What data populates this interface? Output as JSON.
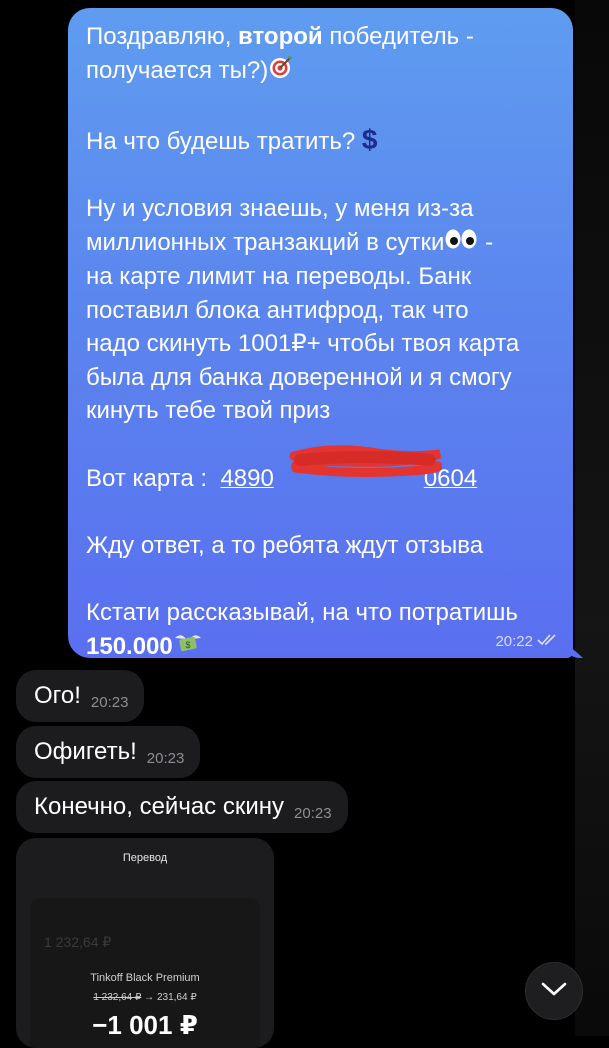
{
  "outgoing_message": {
    "line1_prefix": "Поздравляю, ",
    "line1_bold": "второй",
    "line1_suffix": " победитель -",
    "line2": "получается ты?)",
    "paragraph2": "На что будешь тратить?",
    "paragraph3_a": "Ну и условия знаешь, у меня из-за",
    "paragraph3_b": "миллионных транзакций в сутки",
    "paragraph3_b_tail": " -",
    "paragraph3_c": "на карте лимит на переводы. Банк",
    "paragraph3_d": "поставил блока антифрод, так что",
    "paragraph3_e": "надо скинуть 1001₽+ чтобы твоя карта",
    "paragraph3_f": "была для банка доверенной и я смогу",
    "paragraph3_g": "кинуть тебе твой приз",
    "card_label": "Вот карта :",
    "card_start": "4890",
    "card_end": "0604",
    "paragraph5": "Жду ответ, а то ребята ждут отзыва",
    "paragraph6": "Кстати рассказывай, на что потратишь",
    "amount": "150.000",
    "time": "20:22",
    "icons": [
      "target-emoji",
      "dollar-emoji",
      "eyes-emoji",
      "money-wings-emoji",
      "double-check-icon"
    ]
  },
  "incoming_messages": [
    {
      "text": "Ого!",
      "time": "20:23"
    },
    {
      "text": "Офигеть!",
      "time": "20:23"
    },
    {
      "text": "Конечно, сейчас скину",
      "time": "20:23"
    }
  ],
  "receipt": {
    "title": "Перевод",
    "bank": "Tinkoff Black Premium",
    "balance_before": "1 232,64 ₽",
    "balance_arrow": "→",
    "balance_after": "231,64 ₽",
    "amount": "−1 001 ₽",
    "faded_amount": "1 232,64 ₽"
  },
  "scroll_button": {
    "icon": "chevron-down-icon"
  },
  "colors": {
    "bubble_out_top": "#5f9cf0",
    "bubble_out_bottom": "#5a6ff0",
    "bubble_in": "#1c1c1e",
    "background": "#000000"
  }
}
